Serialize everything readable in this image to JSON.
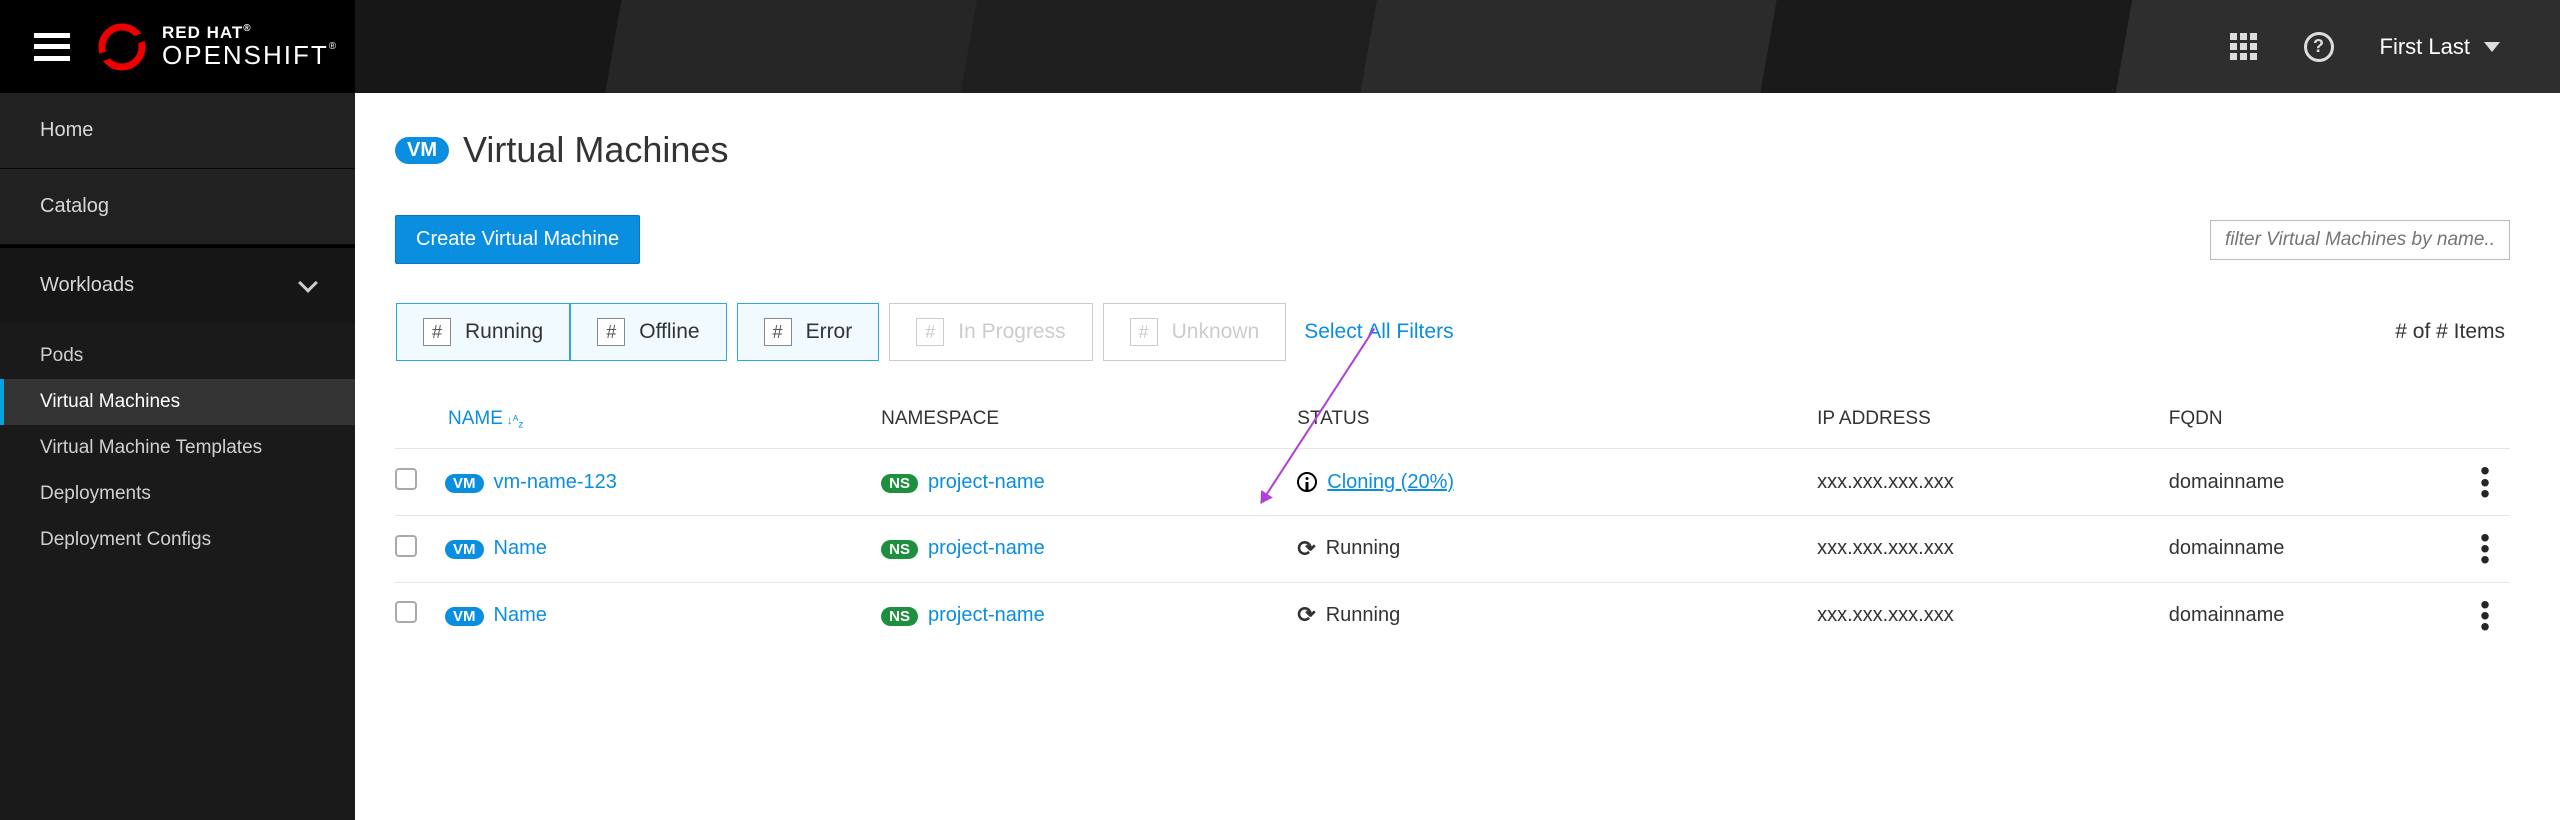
{
  "brand": {
    "line1": "RED HAT",
    "line2": "OPENSHIFT"
  },
  "header": {
    "user": "First Last"
  },
  "sidebar": {
    "primary": [
      "Home",
      "Catalog"
    ],
    "group_label": "Workloads",
    "items": [
      "Pods",
      "Virtual Machines",
      "Virtual Machine Templates",
      "Deployments",
      "Deployment Configs"
    ],
    "active_index": 1
  },
  "page": {
    "badge": "VM",
    "title": "Virtual Machines",
    "create_btn": "Create Virtual Machine",
    "filter_placeholder": "filter Virtual Machines by name...",
    "filters": [
      {
        "count": "#",
        "label": "Running",
        "enabled": true
      },
      {
        "count": "#",
        "label": "Offline",
        "enabled": true
      },
      {
        "count": "#",
        "label": "Error",
        "enabled": true
      },
      {
        "count": "#",
        "label": "In Progress",
        "enabled": false
      },
      {
        "count": "#",
        "label": "Unknown",
        "enabled": false
      }
    ],
    "select_all": "Select All Filters",
    "item_count": "# of # Items"
  },
  "table": {
    "columns": [
      "NAME",
      "NAMESPACE",
      "STATUS",
      "IP ADDRESS",
      "FQDN"
    ],
    "rows": [
      {
        "name": "vm-name-123",
        "ns": "project-name",
        "status_kind": "cloning",
        "status": "Cloning (20%)",
        "ip": "xxx.xxx.xxx.xxx",
        "fqdn": "domainname"
      },
      {
        "name": "Name",
        "ns": "project-name",
        "status_kind": "running",
        "status": "Running",
        "ip": "xxx.xxx.xxx.xxx",
        "fqdn": "domainname"
      },
      {
        "name": "Name",
        "ns": "project-name",
        "status_kind": "running",
        "status": "Running",
        "ip": "xxx.xxx.xxx.xxx",
        "fqdn": "domainname"
      }
    ],
    "badge_vm": "VM",
    "badge_ns": "NS"
  }
}
